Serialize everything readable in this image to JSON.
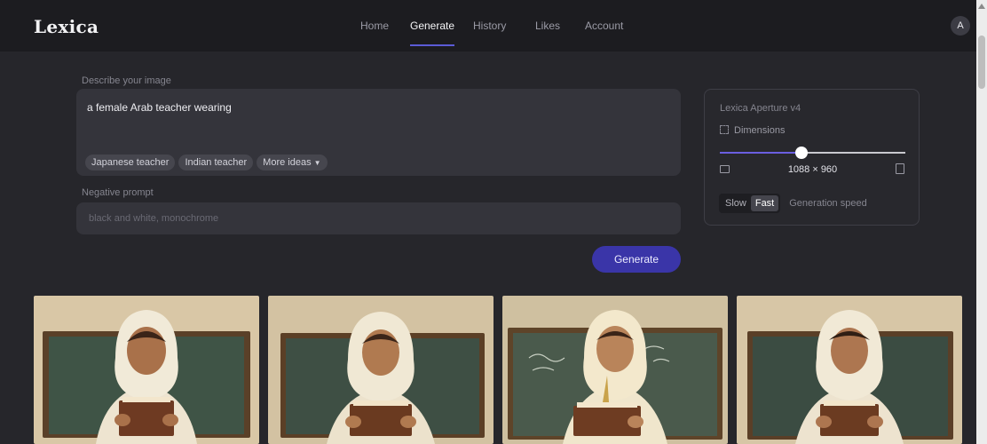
{
  "app": {
    "logo": "Lexica"
  },
  "nav": [
    {
      "label": "Home",
      "active": false
    },
    {
      "label": "Generate",
      "active": true
    },
    {
      "label": "History",
      "active": false
    },
    {
      "label": "Likes",
      "active": false
    },
    {
      "label": "Account",
      "active": false
    }
  ],
  "user": {
    "avatar_initial": "A"
  },
  "prompt": {
    "label": "Describe your image",
    "value": "a female Arab teacher wearing",
    "suggestions": [
      "Japanese teacher",
      "Indian teacher"
    ],
    "more_ideas_label": "More ideas",
    "more_ideas_icon": "chevron-down-icon"
  },
  "negative": {
    "label": "Negative prompt",
    "placeholder": "black and white, monochrome"
  },
  "generate_label": "Generate",
  "settings": {
    "model": "Lexica Aperture v4",
    "dimensions_label": "Dimensions",
    "dimensions_value": "1088 × 960",
    "slider_fraction": 0.44,
    "speed_options": [
      "Slow",
      "Fast"
    ],
    "speed_selected": "Fast",
    "speed_label": "Generation speed"
  },
  "results": [
    {
      "name": "result-image-1",
      "board_color": "#3f5446"
    },
    {
      "name": "result-image-2",
      "board_color": "#3e4f44"
    },
    {
      "name": "result-image-3",
      "board_color": "#4a5a4c"
    },
    {
      "name": "result-image-4",
      "board_color": "#3b4c42"
    }
  ],
  "colors": {
    "background": "#26262b",
    "topbar": "#1c1c20",
    "accent": "#5b5bd6",
    "button": "#3a35a8"
  }
}
